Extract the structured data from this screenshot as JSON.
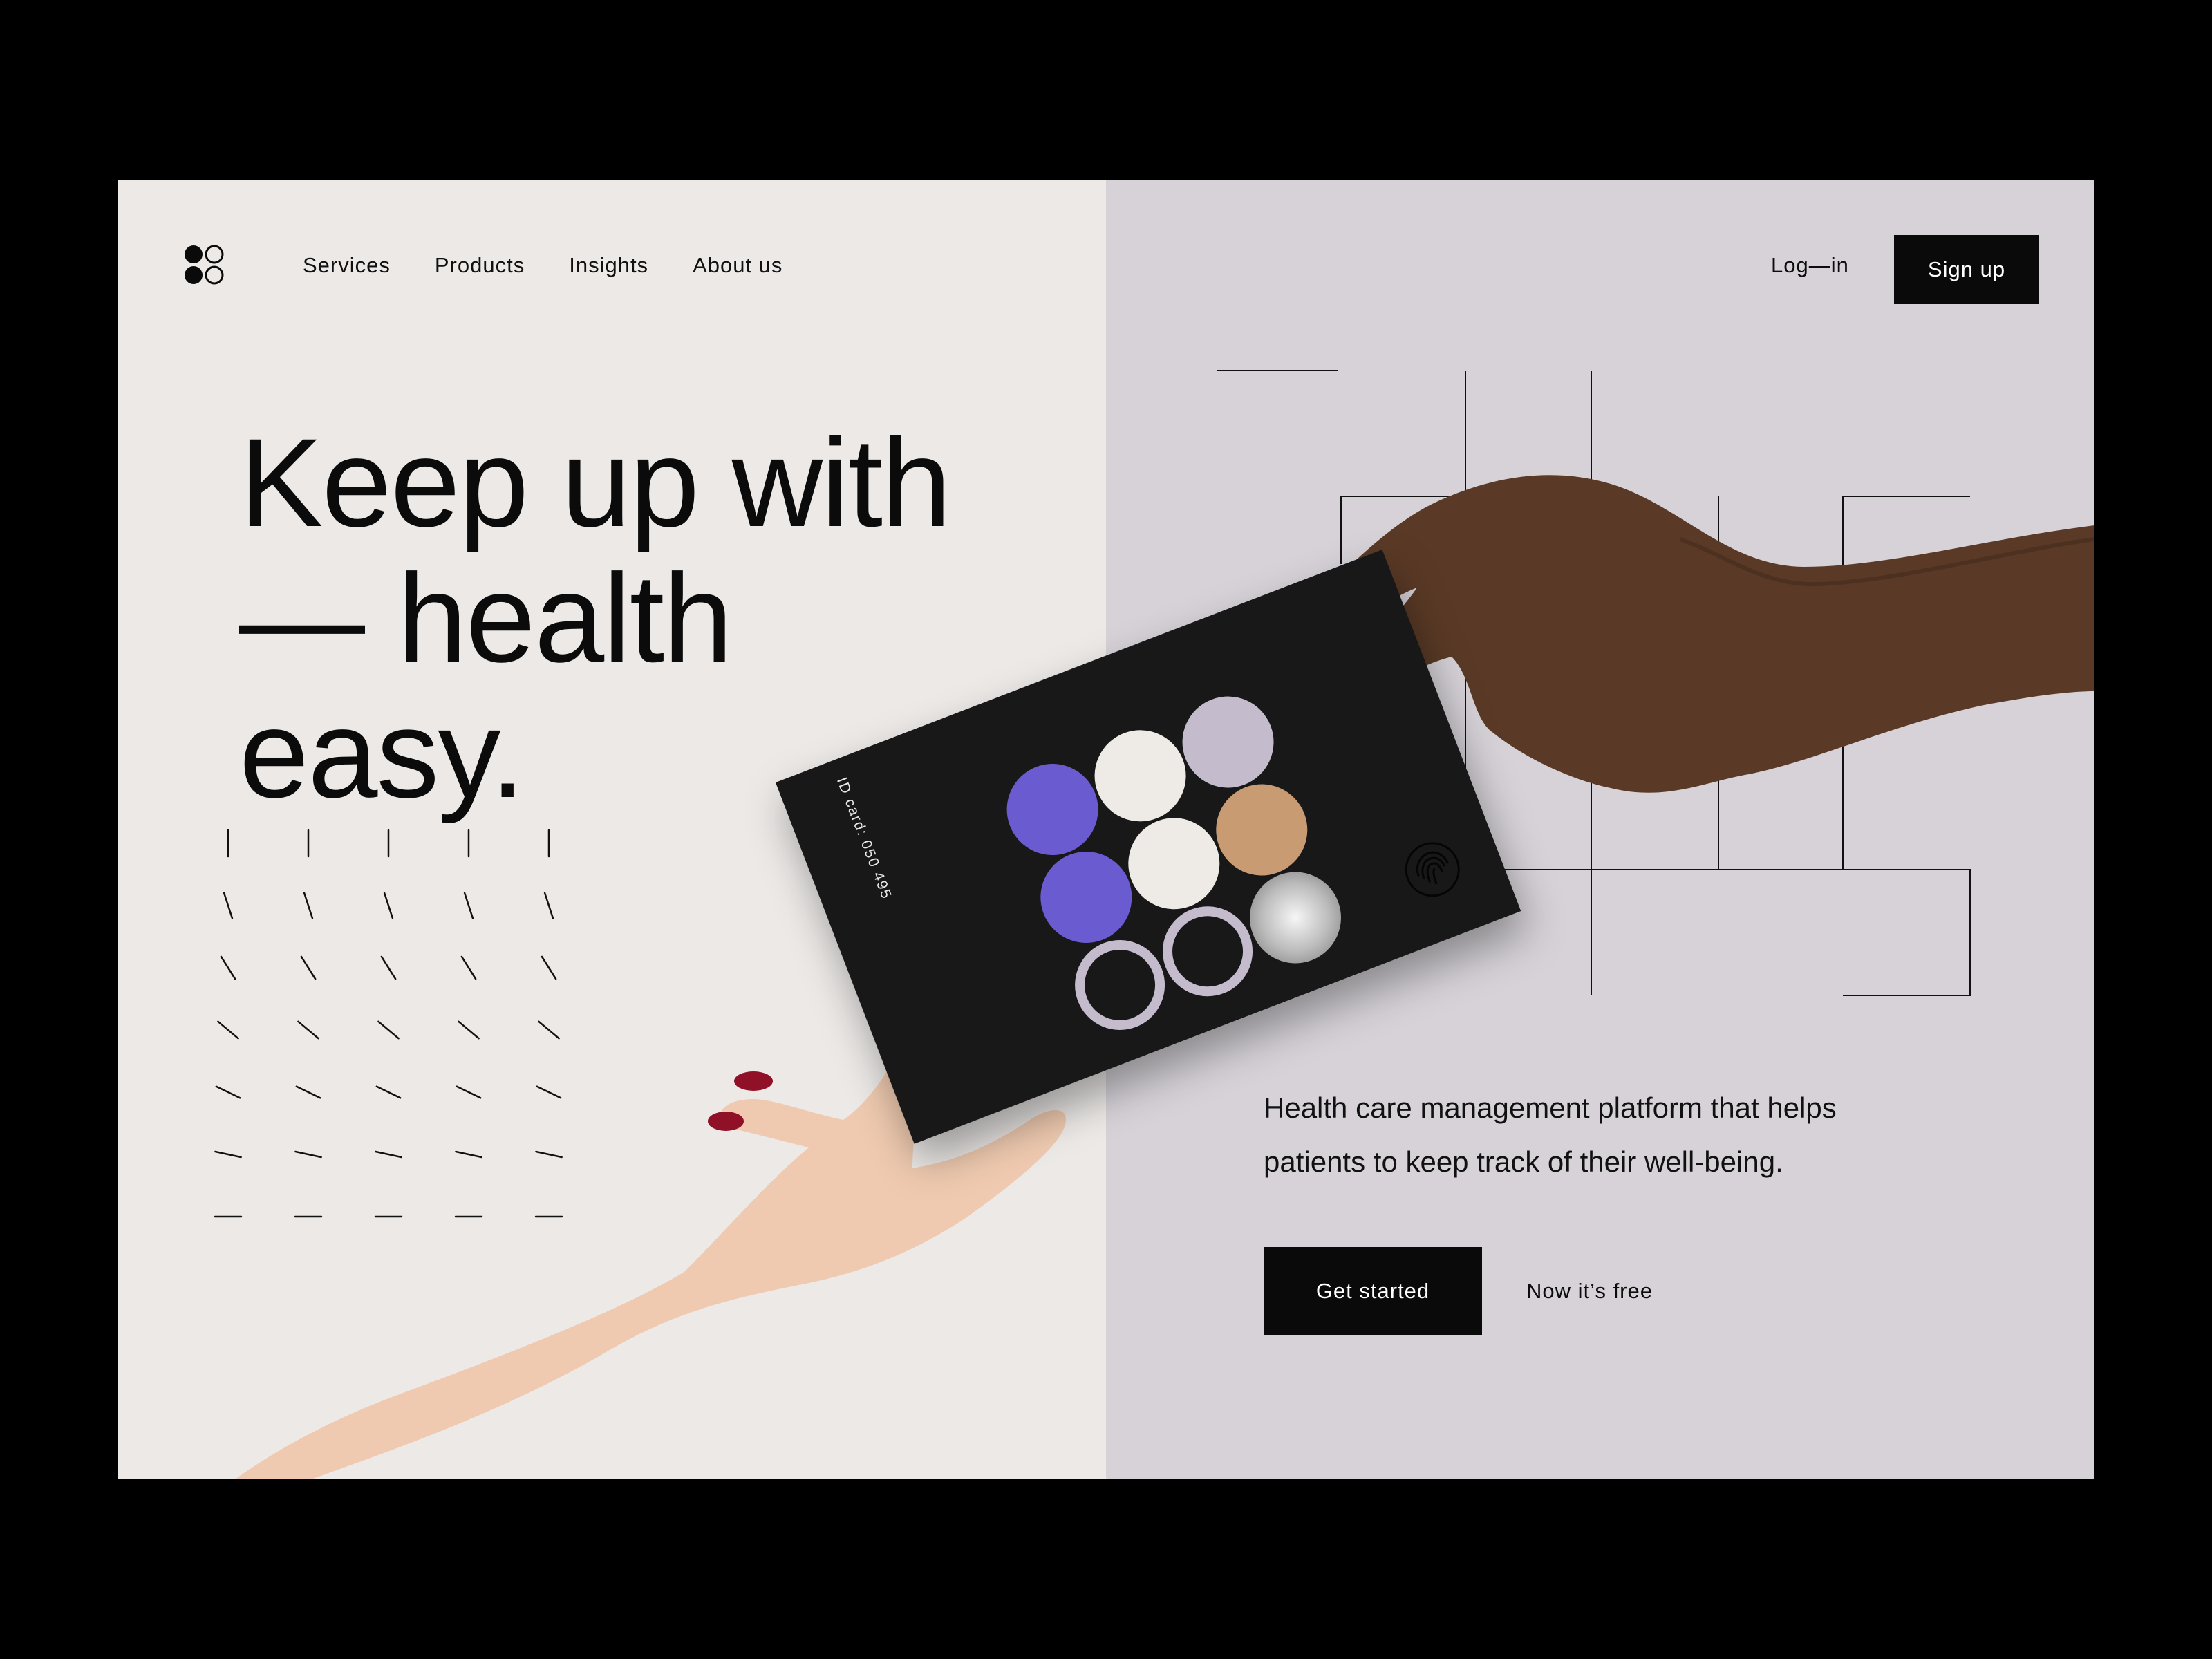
{
  "nav": {
    "logo": "four-circles-logo",
    "items": [
      {
        "label": "Services"
      },
      {
        "label": "Products"
      },
      {
        "label": "Insights"
      },
      {
        "label": "About us"
      }
    ],
    "login_label": "Log—in",
    "signup_label": "Sign up"
  },
  "hero": {
    "headline_lines": [
      "Keep up with",
      "— health",
      "easy."
    ],
    "tagline": "Health care management platform that helps patients to keep track of their well-being.",
    "cta_label": "Get started",
    "cta_note": "Now it’s free"
  },
  "card": {
    "id_text": "ID card: 050 495",
    "dot_colors": [
      "#6b5bd0",
      "#eeeae5",
      "#c4bccd",
      "#c99b72",
      "#b9b9b9"
    ]
  },
  "colors": {
    "left_bg": "#ece9e7",
    "right_bg": "#d6d2d8",
    "button_bg": "#0a0a0a",
    "accent_purple": "#6b5bd0"
  }
}
